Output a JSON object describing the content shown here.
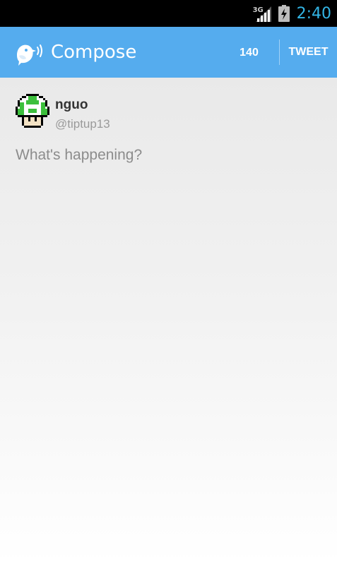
{
  "status_bar": {
    "network_type": "3G",
    "time": "2:40",
    "signal_icon": "signal-strength-icon",
    "battery_icon": "battery-charging-icon"
  },
  "action_bar": {
    "logo_icon": "bird-speaking-logo-icon",
    "title": "Compose",
    "char_count": "140",
    "tweet_label": "TWEET",
    "background_color": "#55acee"
  },
  "user": {
    "avatar_icon": "green-mushroom-avatar-icon",
    "name": "nguo",
    "handle": "@tiptup13"
  },
  "compose": {
    "placeholder": "What's happening?",
    "value": ""
  },
  "colors": {
    "accent": "#33b5e5",
    "action_bar": "#55acee",
    "text_primary": "#333333",
    "text_secondary": "#9a9a9a"
  }
}
